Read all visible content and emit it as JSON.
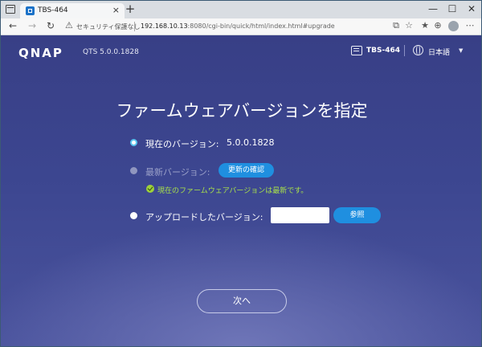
{
  "browser": {
    "tab_title": "TBS-464",
    "tab_close": "×",
    "new_tab": "+",
    "security_text": "セキュリティ保護なし",
    "url_host": "192.168.10.13",
    "url_rest": ":8080/cgi-bin/quick/html/index.html#upgrade",
    "window_minimize": "—",
    "window_maximize": "☐",
    "window_close": "✕",
    "nav_back": "←",
    "nav_forward": "→",
    "nav_reload": "↻"
  },
  "header": {
    "logo": "QNAP",
    "version": "QTS 5.0.0.1828",
    "device_name": "TBS-464",
    "language": "日本語"
  },
  "main": {
    "title": "ファームウェアバージョンを指定",
    "current_label": "現在のバージョン:",
    "current_value": "5.0.0.1828",
    "latest_label": "最新バージョン:",
    "check_button": "更新の確認",
    "latest_status": "現在のファームウェアバージョンは最新です。",
    "upload_label": "アップロードしたバージョン:",
    "upload_value": "",
    "browse_button": "参照",
    "next_button": "次へ"
  },
  "colors": {
    "accent": "#1f8fe0",
    "success": "#a8e04a",
    "background": "#3c4690"
  }
}
